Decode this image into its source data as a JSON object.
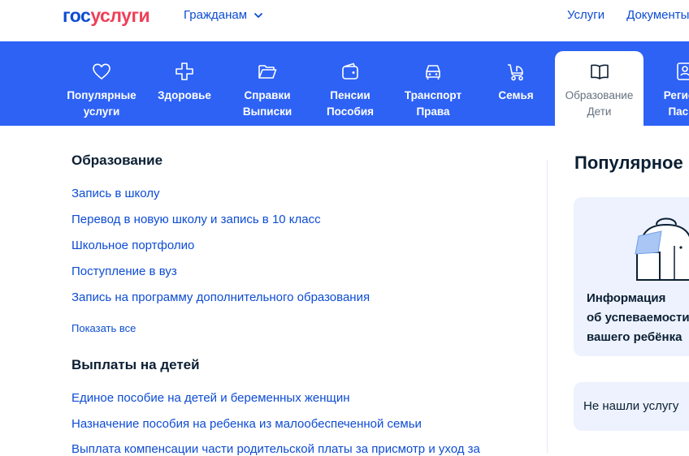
{
  "header": {
    "logo_part1": "гос",
    "logo_part2": "услуги",
    "audience_label": "Гражданам",
    "nav": [
      "Услуги",
      "Документы"
    ]
  },
  "categories": [
    {
      "label": "Популярные\nуслуги",
      "icon": "heart-icon"
    },
    {
      "label": "Здоровье",
      "icon": "medical-cross-icon"
    },
    {
      "label": "Справки\nВыписки",
      "icon": "folder-icon"
    },
    {
      "label": "Пенсии\nПособия",
      "icon": "wallet-icon"
    },
    {
      "label": "Транспорт\nПрава",
      "icon": "car-icon"
    },
    {
      "label": "Семья",
      "icon": "stroller-icon"
    },
    {
      "label": "Образование\nДети",
      "icon": "book-icon",
      "active": true
    },
    {
      "label": "Регистр\nПаспо",
      "icon": "passport-icon"
    }
  ],
  "education": {
    "title": "Образование",
    "links": [
      "Запись в школу",
      "Перевод в новую школу и запись в 10 класс",
      "Школьное портфолио",
      "Поступление в вуз",
      "Запись на программу дополнительного образования"
    ],
    "show_all": "Показать все"
  },
  "child_payments": {
    "title": "Выплаты на детей",
    "links": [
      "Единое пособие на детей и беременных женщин",
      "Назначение пособия на ребенка из малообеспеченной семьи",
      "Выплата компенсации части родительской платы за присмотр и уход за"
    ]
  },
  "popular": {
    "title": "Популярное",
    "card_text": "Информация\nоб успеваемости\nвашего ребёнка",
    "not_found": "Не нашли услугу"
  },
  "colors": {
    "brand_blue": "#0d4cd3",
    "brand_red": "#ee3f58",
    "category_bar": "#2d62f5",
    "card_bg": "#edf2fe"
  }
}
